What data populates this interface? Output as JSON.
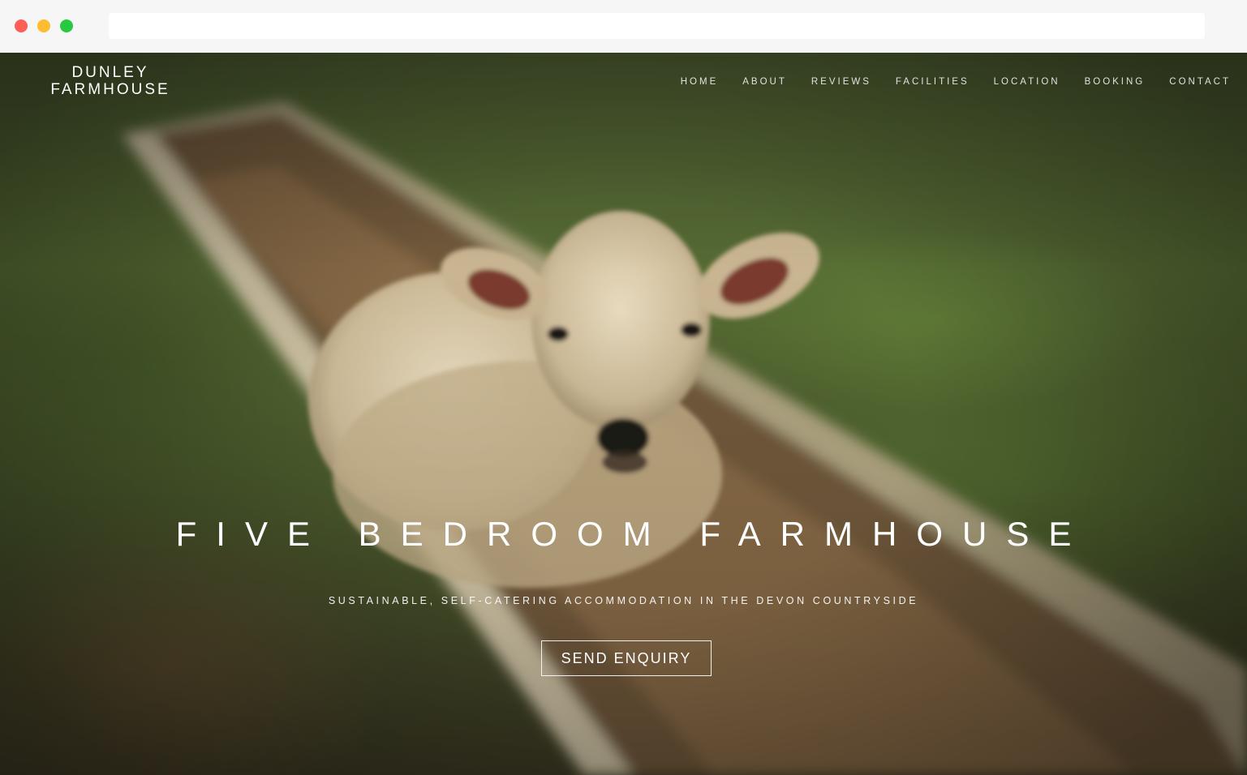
{
  "site": {
    "logo_line1": "DUNLEY",
    "logo_line2": "FARMHOUSE"
  },
  "nav": {
    "items": [
      {
        "label": "HOME"
      },
      {
        "label": "ABOUT"
      },
      {
        "label": "REVIEWS"
      },
      {
        "label": "FACILITIES"
      },
      {
        "label": "LOCATION"
      },
      {
        "label": "BOOKING"
      },
      {
        "label": "CONTACT"
      }
    ]
  },
  "hero": {
    "title": "FIVE BEDROOM FARMHOUSE",
    "subtitle": "SUSTAINABLE, SELF-CATERING ACCOMMODATION IN THE DEVON COUNTRYSIDE",
    "cta_label": "SEND ENQUIRY",
    "background_image": "lamb-in-trough-photo"
  },
  "colors": {
    "traffic_red": "#fd5f57",
    "traffic_yellow": "#febc2e",
    "traffic_green": "#28c840",
    "text": "#ffffff"
  }
}
